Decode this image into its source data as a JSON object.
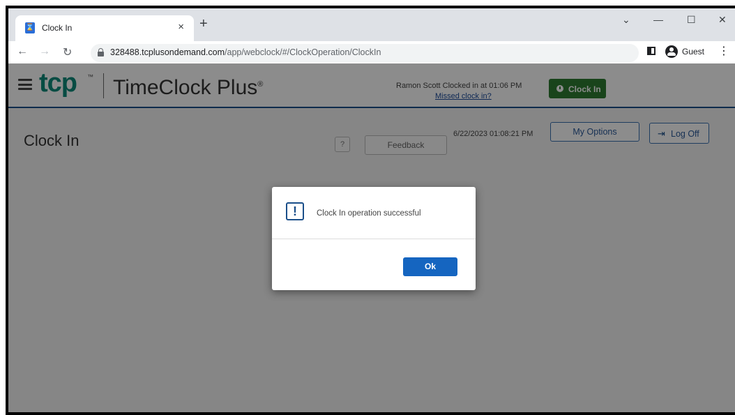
{
  "browser": {
    "tab_title": "Clock In",
    "tab_close": "×",
    "new_tab": "+",
    "url_domain": "328488.tcplusondemand.com",
    "url_path": "/app/webclock/#/ClockOperation/ClockIn",
    "profile_label": "Guest",
    "window_controls": {
      "dropdown": "⌄",
      "minimize": "—",
      "maximize": "☐",
      "close": "✕"
    },
    "nav": {
      "back": "←",
      "forward": "→",
      "reload": "↻",
      "menu": "⋮"
    }
  },
  "header": {
    "logo": "tcp",
    "logo_tm": "™",
    "product": "TimeClock Plus",
    "product_mark": "®",
    "status": "Ramon Scott Clocked in at 01:06 PM",
    "missed_link": "Missed clock in?",
    "clockin_button": "Clock In"
  },
  "page": {
    "title": "Clock In",
    "help_button": "?",
    "feedback_button": "Feedback",
    "datetime": "6/22/2023 01:08:21 PM",
    "my_options_button": "My Options",
    "logoff_button": "Log Off",
    "logoff_icon": "⇥"
  },
  "modal": {
    "icon": "!",
    "message": "Clock In operation successful",
    "ok_button": "Ok"
  },
  "colors": {
    "brand_teal": "#0d8a7a",
    "header_rule": "#1b4f8a",
    "clockin_green": "#2e7d32",
    "primary_blue": "#1565c0"
  }
}
